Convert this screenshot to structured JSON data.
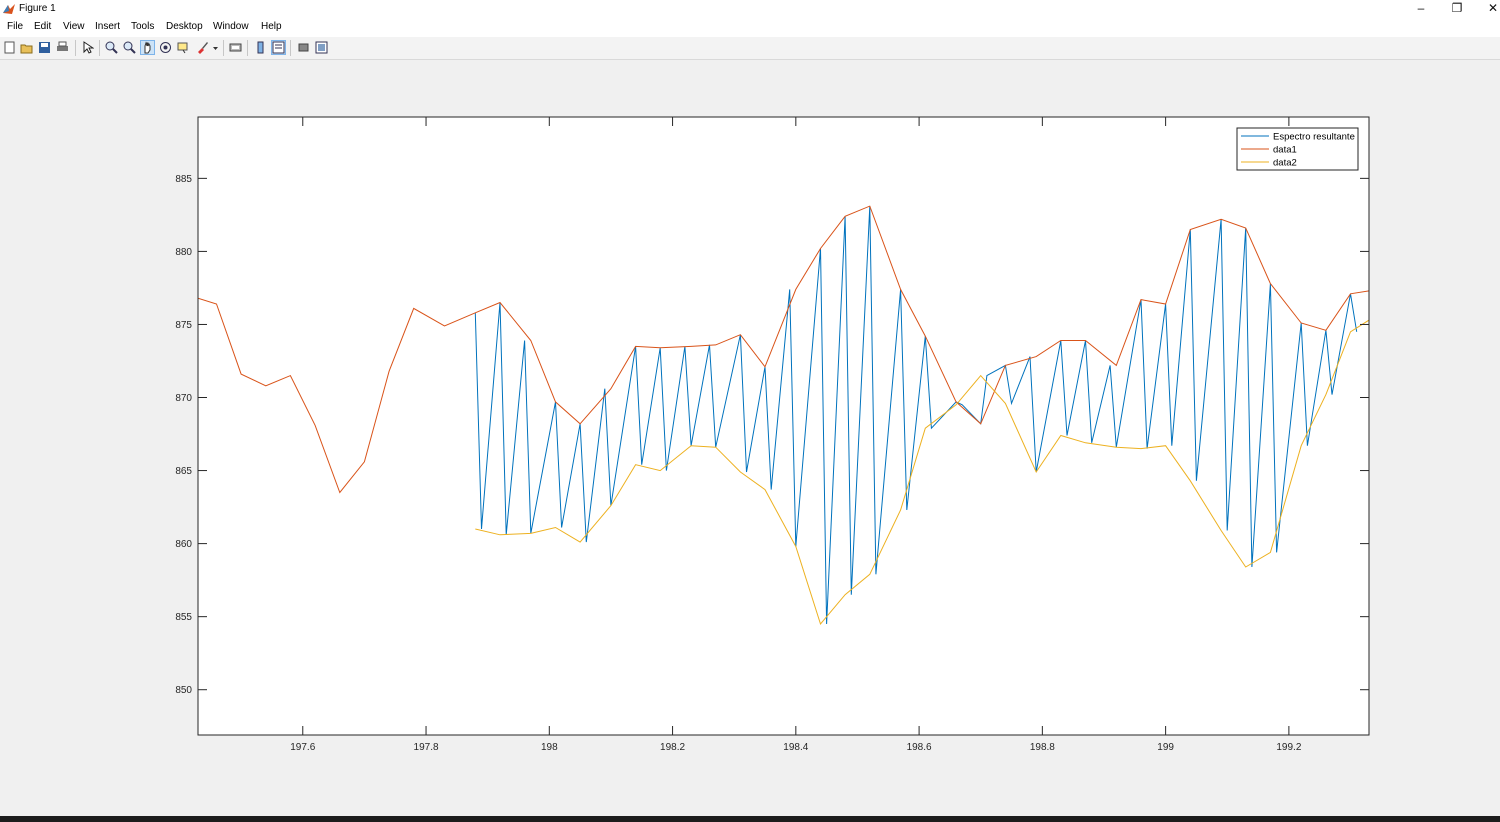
{
  "window": {
    "title": "Figure 1",
    "minimize": "–",
    "maximize": "❐",
    "close": "✕"
  },
  "menu": [
    "File",
    "Edit",
    "View",
    "Insert",
    "Tools",
    "Desktop",
    "Window",
    "Help"
  ],
  "toolbar": [
    "new-figure-icon",
    "open-icon",
    "save-icon",
    "print-icon",
    "pointer-icon",
    "zoom-in-icon",
    "zoom-out-icon",
    "pan-icon",
    "rotate-icon",
    "data-cursor-icon",
    "brush-icon",
    "link-icon",
    "colorbar-icon",
    "legend-icon",
    "hide-plot-tools-icon",
    "show-plot-tools-icon"
  ],
  "colors": {
    "series1": "#0072BD",
    "series2": "#D95319",
    "series3": "#EDB120"
  },
  "chart_data": {
    "type": "line",
    "xlim": [
      197.43,
      199.33
    ],
    "ylim": [
      846.9,
      889.2
    ],
    "xticks": [
      197.6,
      197.8,
      198,
      198.2,
      198.4,
      198.6,
      198.8,
      199,
      199.2
    ],
    "xtick_labels": [
      "197.6",
      "197.8",
      "198",
      "198.2",
      "198.4",
      "198.6",
      "198.8",
      "199",
      "199.2"
    ],
    "yticks": [
      850,
      855,
      860,
      865,
      870,
      875,
      880,
      885
    ],
    "ytick_labels": [
      "850",
      "855",
      "860",
      "865",
      "870",
      "875",
      "880",
      "885"
    ],
    "legend": {
      "position": "top-right",
      "entries": [
        "Espectro resultante",
        "data1",
        "data2"
      ]
    },
    "series": [
      {
        "name": "Espectro resultante",
        "x": [
          197.88,
          197.89,
          197.92,
          197.93,
          197.96,
          197.97,
          198.01,
          198.02,
          198.05,
          198.06,
          198.09,
          198.1,
          198.14,
          198.15,
          198.18,
          198.19,
          198.22,
          198.23,
          198.26,
          198.27,
          198.31,
          198.32,
          198.35,
          198.36,
          198.39,
          198.4,
          198.44,
          198.45,
          198.48,
          198.49,
          198.52,
          198.53,
          198.57,
          198.58,
          198.61,
          198.62,
          198.66,
          198.67,
          198.7,
          198.71,
          198.74,
          198.75,
          198.78,
          198.79,
          198.83,
          198.84,
          198.87,
          198.88,
          198.91,
          198.92,
          198.96,
          198.97,
          199.0,
          199.01,
          199.04,
          199.05,
          199.09,
          199.1,
          199.13,
          199.14,
          199.17,
          199.18,
          199.22,
          199.23,
          199.26,
          199.27,
          199.3,
          199.31
        ],
        "y": [
          875.8,
          861.0,
          876.5,
          860.6,
          873.9,
          860.7,
          869.7,
          861.1,
          868.2,
          860.1,
          870.6,
          862.6,
          873.5,
          865.4,
          873.4,
          865.0,
          873.5,
          866.7,
          873.6,
          866.6,
          874.3,
          864.9,
          872.1,
          863.7,
          877.4,
          859.8,
          880.2,
          854.5,
          882.4,
          856.5,
          883.1,
          857.9,
          877.4,
          862.3,
          874.2,
          867.9,
          869.7,
          869.5,
          868.2,
          871.5,
          872.2,
          869.6,
          872.8,
          864.9,
          873.9,
          867.4,
          873.9,
          866.9,
          872.2,
          866.6,
          876.7,
          866.5,
          876.4,
          866.7,
          881.5,
          864.3,
          882.2,
          860.9,
          881.6,
          858.4,
          877.8,
          859.4,
          875.1,
          866.7,
          874.6,
          870.2,
          877.1,
          874.5
        ]
      },
      {
        "name": "data1",
        "x": [
          197.43,
          197.46,
          197.5,
          197.54,
          197.58,
          197.62,
          197.66,
          197.7,
          197.74,
          197.78,
          197.83,
          197.88,
          197.92,
          197.97,
          198.01,
          198.05,
          198.1,
          198.14,
          198.18,
          198.23,
          198.27,
          198.31,
          198.35,
          198.4,
          198.44,
          198.48,
          198.52,
          198.57,
          198.61,
          198.66,
          198.7,
          198.74,
          198.79,
          198.83,
          198.87,
          198.92,
          198.96,
          199.0,
          199.04,
          199.09,
          199.13,
          199.17,
          199.22,
          199.26,
          199.3,
          199.33
        ],
        "y": [
          876.8,
          876.4,
          871.6,
          870.8,
          871.5,
          868.1,
          863.5,
          865.6,
          871.8,
          876.1,
          874.9,
          875.8,
          876.5,
          873.9,
          869.7,
          868.2,
          870.6,
          873.5,
          873.4,
          873.5,
          873.6,
          874.3,
          872.1,
          877.4,
          880.2,
          882.4,
          883.1,
          877.4,
          874.2,
          869.7,
          868.2,
          872.2,
          872.8,
          873.9,
          873.9,
          872.2,
          876.7,
          876.4,
          881.5,
          882.2,
          881.6,
          877.8,
          875.1,
          874.6,
          877.1,
          877.3
        ]
      },
      {
        "name": "data2",
        "x": [
          197.88,
          197.92,
          197.97,
          198.01,
          198.05,
          198.1,
          198.14,
          198.18,
          198.23,
          198.27,
          198.31,
          198.35,
          198.4,
          198.44,
          198.48,
          198.52,
          198.57,
          198.61,
          198.66,
          198.7,
          198.74,
          198.79,
          198.83,
          198.87,
          198.92,
          198.96,
          199.0,
          199.04,
          199.09,
          199.13,
          199.17,
          199.22,
          199.26,
          199.3,
          199.33
        ],
        "y": [
          861.0,
          860.6,
          860.7,
          861.1,
          860.1,
          862.6,
          865.4,
          865.0,
          866.7,
          866.6,
          864.9,
          863.7,
          859.8,
          854.5,
          856.5,
          857.9,
          862.3,
          867.9,
          869.5,
          871.5,
          869.6,
          864.9,
          867.4,
          866.9,
          866.6,
          866.5,
          866.7,
          864.3,
          860.9,
          858.4,
          859.4,
          866.7,
          870.2,
          874.5,
          875.3
        ]
      }
    ]
  }
}
